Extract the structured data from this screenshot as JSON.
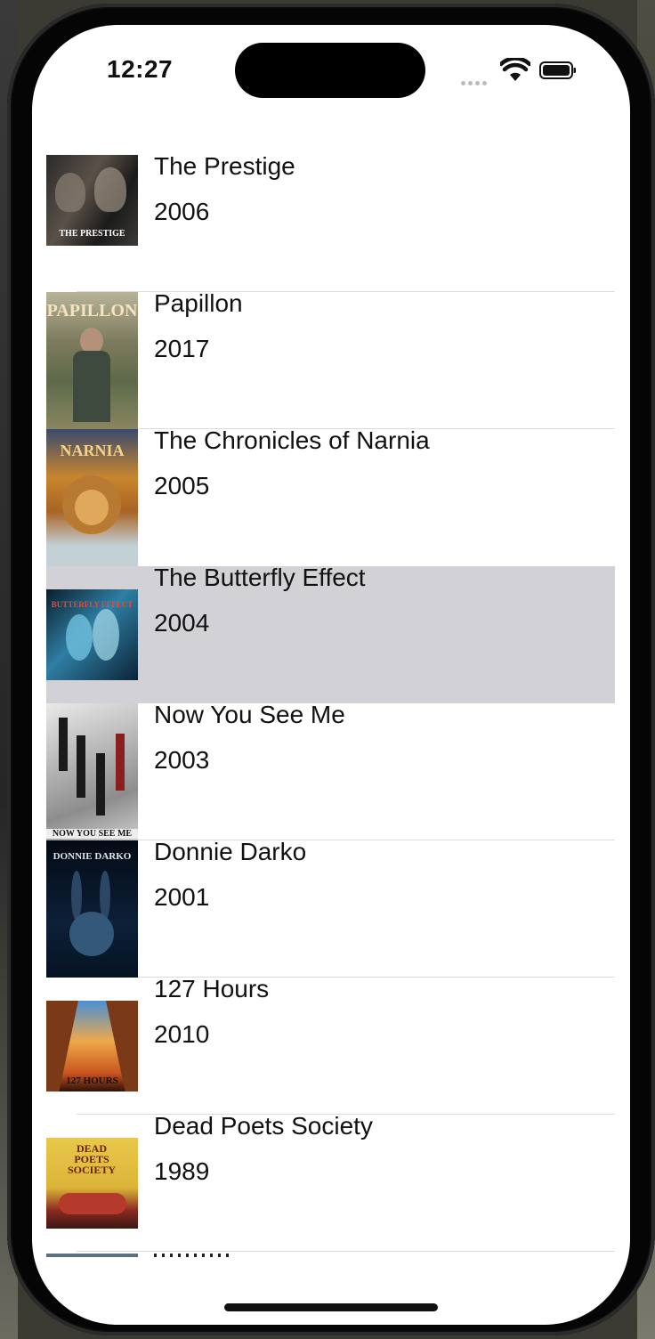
{
  "status_bar": {
    "time": "12:27"
  },
  "movies": [
    {
      "title": "The Prestige",
      "year": "2006",
      "poster_label": "THE PRESTIGE",
      "selected": false
    },
    {
      "title": "Papillon",
      "year": "2017",
      "poster_label": "PAPILLON",
      "selected": false
    },
    {
      "title": "The Chronicles of Narnia",
      "year": "2005",
      "poster_label": "NARNIA",
      "selected": false
    },
    {
      "title": "The Butterfly Effect",
      "year": "2004",
      "poster_label": "BUTTERFLY EFFECT",
      "selected": true
    },
    {
      "title": "Now You See Me",
      "year": "2003",
      "poster_label": "NOW YOU SEE ME",
      "selected": false
    },
    {
      "title": "Donnie Darko",
      "year": "2001",
      "poster_label": "DONNIE DARKO",
      "selected": false
    },
    {
      "title": "127 Hours",
      "year": "2010",
      "poster_label": "127 HOURS",
      "selected": false
    },
    {
      "title": "Dead Poets Society",
      "year": "1989",
      "poster_label": "DEAD POETS SOCIETY",
      "selected": false
    }
  ],
  "colors": {
    "selected_row": "#d1d1d6",
    "separator": "#dcdce0"
  }
}
